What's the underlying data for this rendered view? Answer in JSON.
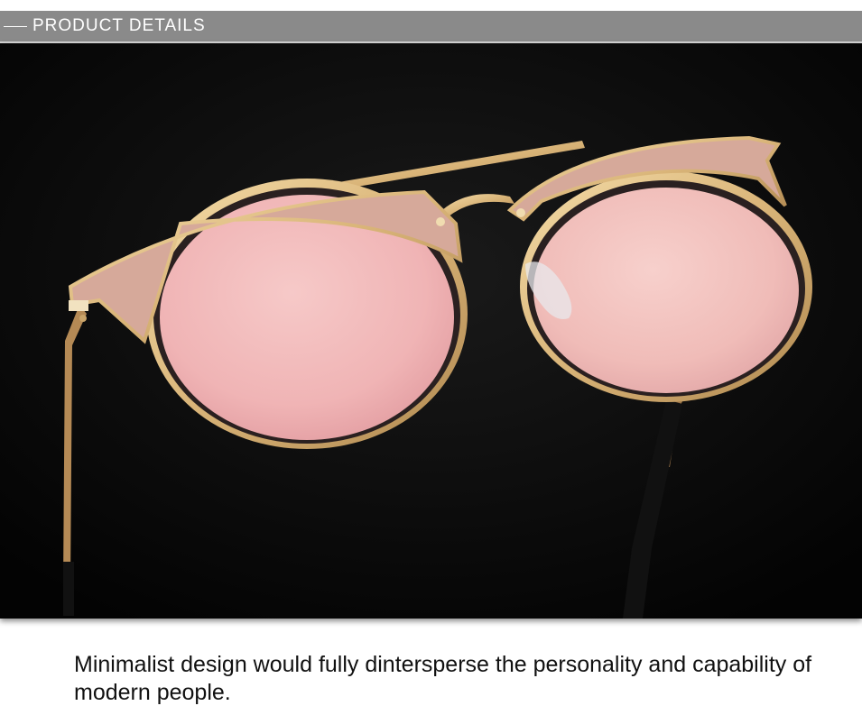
{
  "header": {
    "title": "PRODUCT DETAILS",
    "background_color": "#8a8a8a"
  },
  "photo": {
    "subject_icon": "sunglasses-photo",
    "lens_color": "#f2b8b8",
    "frame_color": "#e0c08a",
    "background_color": "#050505"
  },
  "caption": {
    "text": "Minimalist design would fully dintersperse the personality and capability of modern people."
  }
}
